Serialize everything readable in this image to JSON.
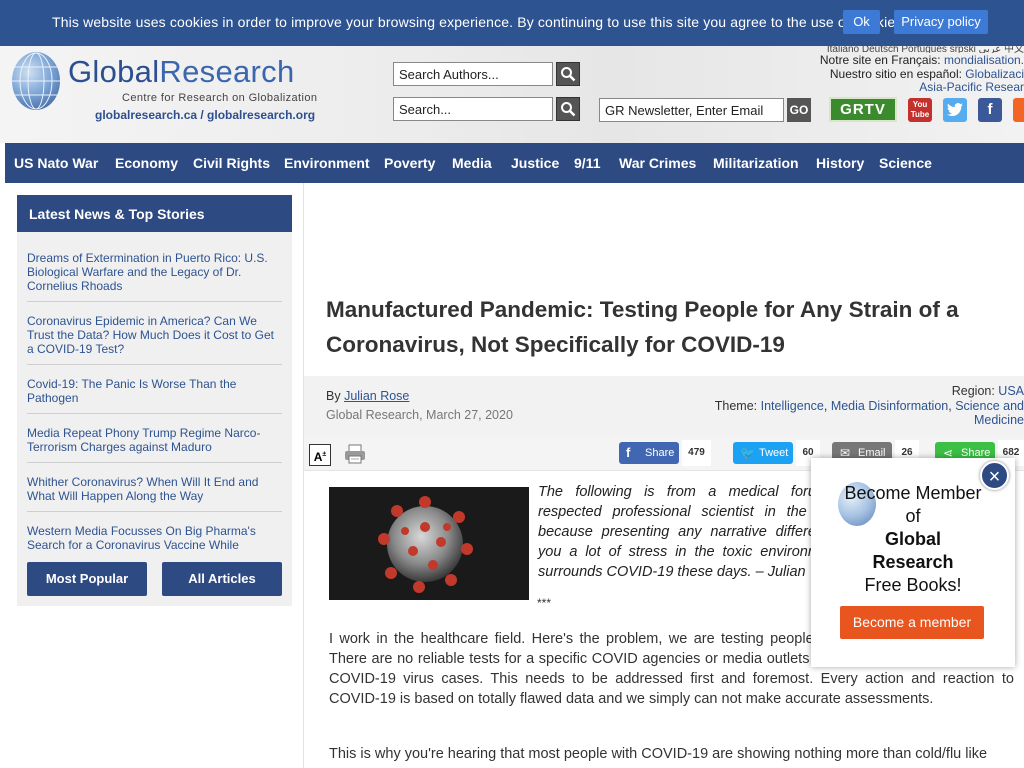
{
  "cookie_bar": {
    "message": "This website uses cookies in order to improve your browsing experience. By continuing to use this site you agree to the use of cookies.",
    "ok_label": "Ok",
    "privacy_label": "Privacy policy"
  },
  "header": {
    "logo_global": "Global",
    "logo_research": "Research",
    "logo_subtitle": "Centre for Research on Globalization",
    "logo_urls": "globalresearch.ca / globalresearch.org",
    "search_authors_placeholder": "Search Authors...",
    "search_placeholder": "Search...",
    "newsletter_placeholder": "GR Newsletter, Enter Email",
    "go_label": "GO",
    "languages_top": "Italiano  Deutsch  Português  srpski  عربي  中文",
    "french_label": "Notre site en Français: ",
    "french_link": "mondialisation.",
    "spanish_label": "Nuestro sitio en español: ",
    "spanish_link": "Globalizaci",
    "asia_link": "Asia-Pacific Resear",
    "grtv_label": "GRTV",
    "youtube_label": "You Tube"
  },
  "nav": {
    "items": [
      "US Nato War",
      "Economy",
      "Civil Rights",
      "Environment",
      "Poverty",
      "Media",
      "Justice",
      "9/11",
      "War Crimes",
      "Militarization",
      "History",
      "Science"
    ]
  },
  "sidebar": {
    "heading": "Latest News & Top Stories",
    "items": [
      "Dreams of Extermination in Puerto Rico: U.S. Biological Warfare and the Legacy of Dr. Cornelius Rhoads",
      "Coronavirus Epidemic in America? Can We Trust the Data? How Much Does it Cost to Get a COVID-19 Test?",
      "Covid-19: The Panic Is Worse Than the Pathogen",
      "Media Repeat Phony Trump Regime Narco-Terrorism Charges against Maduro",
      "Whither Coronavirus? When Will It End and What Will Happen Along the Way",
      "Western Media Focusses On Big Pharma's Search for a Coronavirus Vaccine While"
    ],
    "most_popular_label": "Most Popular",
    "all_articles_label": "All Articles"
  },
  "article": {
    "title": "Manufactured Pandemic: Testing People for Any Strain of a Coronavirus, Not Specifically for COVID-19",
    "by_label": "By ",
    "author": "Julian Rose",
    "source_date": "Global Research, March 27, 2020",
    "region_label": "Region: ",
    "region": "USA",
    "theme_label": "Theme: ",
    "themes": [
      "Intelligence",
      "Media Disinformation",
      "Science and"
    ],
    "theme_wrap": "Medicine",
    "intro": "The following is from a medical forum respected professional scientist in the U because presenting any narrative different you a lot of stress in the toxic environme surrounds COVID-19 these days. – Julian",
    "separator": "***",
    "para1": "I work in the healthcare field. Here's the problem, we are testing people for specifically for COVID-19. There are no reliable tests for a specific COVID agencies or media outlets for reporting numbers of actual COVID-19 virus cases. This needs to be addressed first and foremost. Every action and reaction to COVID-19 is based on totally flawed data and we simply can not make accurate assessments.",
    "para2": "This is why you're hearing that most people with COVID-19 are showing nothing more than cold/flu like"
  },
  "share": {
    "facebook_label": "Share",
    "facebook_count": "479",
    "twitter_label": "Tweet",
    "twitter_count": "60",
    "email_label": "Email",
    "email_count": "26",
    "share_label": "Share",
    "share_count": "682"
  },
  "popup": {
    "line1": "Become Member",
    "line2": "of",
    "line3": "Global",
    "line4": "Research",
    "line5": "Free Books!",
    "button_label": "Become a member",
    "close_label": "×"
  },
  "colors": {
    "brand_blue": "#2e4a83",
    "cookie_blue": "#2e5391",
    "popup_orange": "#e8551e"
  }
}
